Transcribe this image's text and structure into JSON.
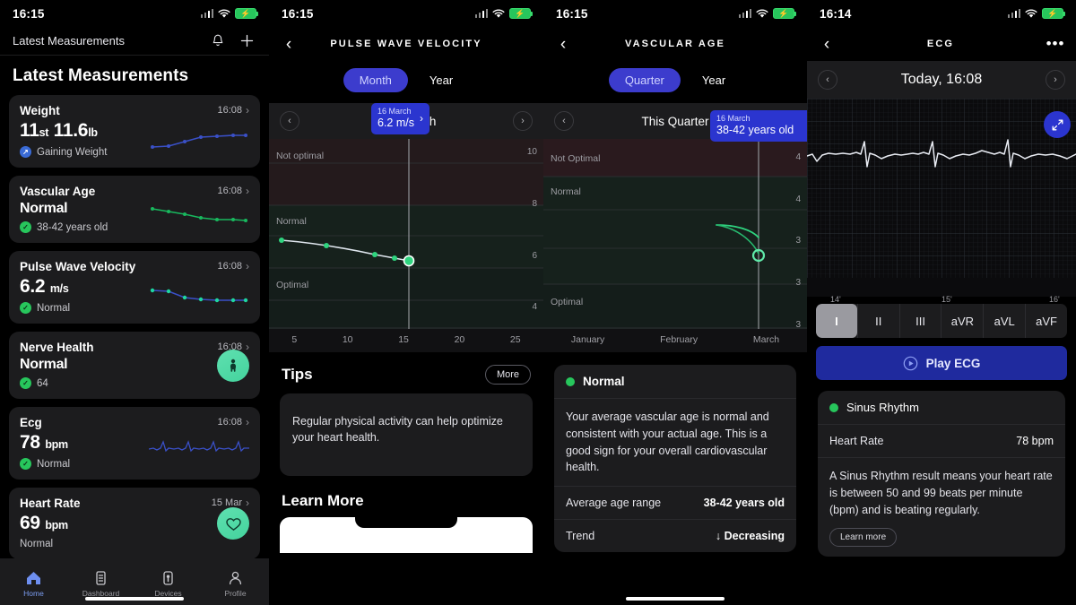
{
  "panel1": {
    "status": {
      "time": "16:15"
    },
    "navbar_title": "Latest Measurements",
    "page_title": "Latest Measurements",
    "bell_icon": "bell-icon",
    "plus_icon": "plus-icon",
    "cards": [
      {
        "name": "Weight",
        "time": "16:08",
        "value": "11",
        "unit1": "st",
        "value2": "11.6",
        "unit2": "lb",
        "sub": "Gaining Weight",
        "sub_icon": "trend-up-badge",
        "badge": "blue",
        "spark": "weight"
      },
      {
        "name": "Vascular Age",
        "time": "16:08",
        "value": "Normal",
        "sub": "38-42 years old",
        "sub_icon": "check-badge",
        "badge": "green",
        "spark": "vascular"
      },
      {
        "name": "Pulse Wave Velocity",
        "time": "16:08",
        "value": "6.2",
        "unit1": "m/s",
        "sub": "Normal",
        "sub_icon": "check-badge",
        "badge": "green",
        "spark": "pwv"
      },
      {
        "name": "Nerve Health",
        "time": "16:08",
        "value": "Normal",
        "sub": "64",
        "sub_icon": "check-badge",
        "badge": "green",
        "circle": "body-icon"
      },
      {
        "name": "Ecg",
        "time": "16:08",
        "value": "78",
        "unit1": "bpm",
        "sub": "Normal",
        "sub_icon": "check-badge",
        "badge": "green",
        "spark": "ecg"
      },
      {
        "name": "Heart Rate",
        "time": "15 Mar",
        "value": "69",
        "unit1": "bpm",
        "sub": "Normal",
        "sub_icon": "none",
        "badge": "none",
        "circle": "heart-icon"
      }
    ],
    "tabs": [
      {
        "label": "Home",
        "icon": "home-icon",
        "active": true
      },
      {
        "label": "Dashboard",
        "icon": "dashboard-icon",
        "active": false
      },
      {
        "label": "Devices",
        "icon": "devices-icon",
        "active": false
      },
      {
        "label": "Profile",
        "icon": "profile-icon",
        "active": false
      }
    ]
  },
  "panel2": {
    "status": {
      "time": "16:15"
    },
    "navbar_title": "PULSE WAVE VELOCITY",
    "segments": [
      {
        "label": "Month",
        "selected": true
      },
      {
        "label": "Year",
        "selected": false
      }
    ],
    "period_label": "This Month",
    "bubble": {
      "date": "16 March",
      "value": "6.2 m/s"
    },
    "tips": {
      "heading": "Tips",
      "more_label": "More",
      "text": "Regular physical activity can help optimize your heart health."
    },
    "learn_more_heading": "Learn More",
    "chart_data": {
      "type": "line",
      "title": "Pulse Wave Velocity - This Month",
      "xlabel": "",
      "ylabel": "m/s",
      "x": [
        1,
        5,
        10,
        13,
        14,
        16
      ],
      "values": [
        6.45,
        6.35,
        6.25,
        6.15,
        6.1,
        6.2
      ],
      "tick_labels": [
        "5",
        "10",
        "15",
        "20",
        "25"
      ],
      "ytick_labels": [
        "10",
        "8",
        "6",
        "4"
      ],
      "ylim": [
        3.4,
        10.6
      ],
      "bands": [
        {
          "label": "Not optimal",
          "color": "#241a1c"
        },
        {
          "label": "Normal",
          "color": "#16211c"
        },
        {
          "label": "Optimal",
          "color": "#141d1a"
        }
      ],
      "selected_point": {
        "x": 16,
        "y": 6.2,
        "label": "16 March",
        "value": "6.2 m/s"
      },
      "line_color": "#dfe6ee",
      "point_color": "#2fd47f",
      "grid": true,
      "legend": "none"
    }
  },
  "panel3": {
    "status": {
      "time": "16:15"
    },
    "navbar_title": "VASCULAR AGE",
    "segments": [
      {
        "label": "Quarter",
        "selected": true
      },
      {
        "label": "Year",
        "selected": false
      }
    ],
    "period_label": "This Quarter",
    "bubble": {
      "date": "16 March",
      "value": "38-42 years old"
    },
    "info": {
      "status": "Normal",
      "text": "Your average vascular age is normal and consistent with your actual age. This is a good sign for your overall cardiovascular health.",
      "rows": [
        {
          "key": "Average age range",
          "value": "38-42 years old"
        },
        {
          "key": "Trend",
          "value": "Decreasing",
          "arrow": "↓"
        }
      ]
    },
    "chart_data": {
      "type": "line",
      "title": "Vascular Age - This Quarter",
      "xlabel": "",
      "ylabel": "years",
      "categories": [
        "January",
        "February",
        "March"
      ],
      "values": [
        null,
        41,
        38
      ],
      "tick_labels": [
        "January",
        "February",
        "March"
      ],
      "ytick_labels": [
        "4",
        "4",
        "3",
        "3",
        "3"
      ],
      "bands": [
        {
          "label": "Not Optimal",
          "color": "#2a1a1e"
        },
        {
          "label": "Normal",
          "color": "#16211c"
        },
        {
          "label": "Optimal",
          "color": "#141d1a"
        }
      ],
      "selected_point": {
        "x": "March",
        "y": 38,
        "label": "16 March",
        "value": "38-42 years old"
      },
      "line_color": "#2fd47f",
      "point_color": "#2fd47f",
      "grid": true,
      "legend": "none"
    }
  },
  "panel4": {
    "status": {
      "time": "16:14"
    },
    "navbar_title": "ECG",
    "menu_icon": "ellipsis-icon",
    "period_label": "Today, 16:08",
    "fab_icon": "expand-icon",
    "x_ticks": [
      "14'",
      "15'",
      "16'"
    ],
    "leads": [
      {
        "label": "I",
        "selected": true
      },
      {
        "label": "II",
        "selected": false
      },
      {
        "label": "III",
        "selected": false
      },
      {
        "label": "aVR",
        "selected": false
      },
      {
        "label": "aVL",
        "selected": false
      },
      {
        "label": "aVF",
        "selected": false
      }
    ],
    "play_label": "Play ECG",
    "play_icon": "play-circle-icon",
    "info": {
      "status": "Sinus Rhythm",
      "rows": [
        {
          "key": "Heart Rate",
          "value": "78 bpm"
        }
      ],
      "text": "A Sinus Rhythm result means your heart rate is between 50 and 99 beats per minute (bpm) and is beating regularly.",
      "learn_more": "Learn more"
    }
  },
  "colors": {
    "accent_blue": "#2b35cf",
    "accent_green": "#27c65c",
    "mint": "#5fe0b0",
    "card_bg": "#1c1c1e",
    "page_bg": "#000000"
  }
}
